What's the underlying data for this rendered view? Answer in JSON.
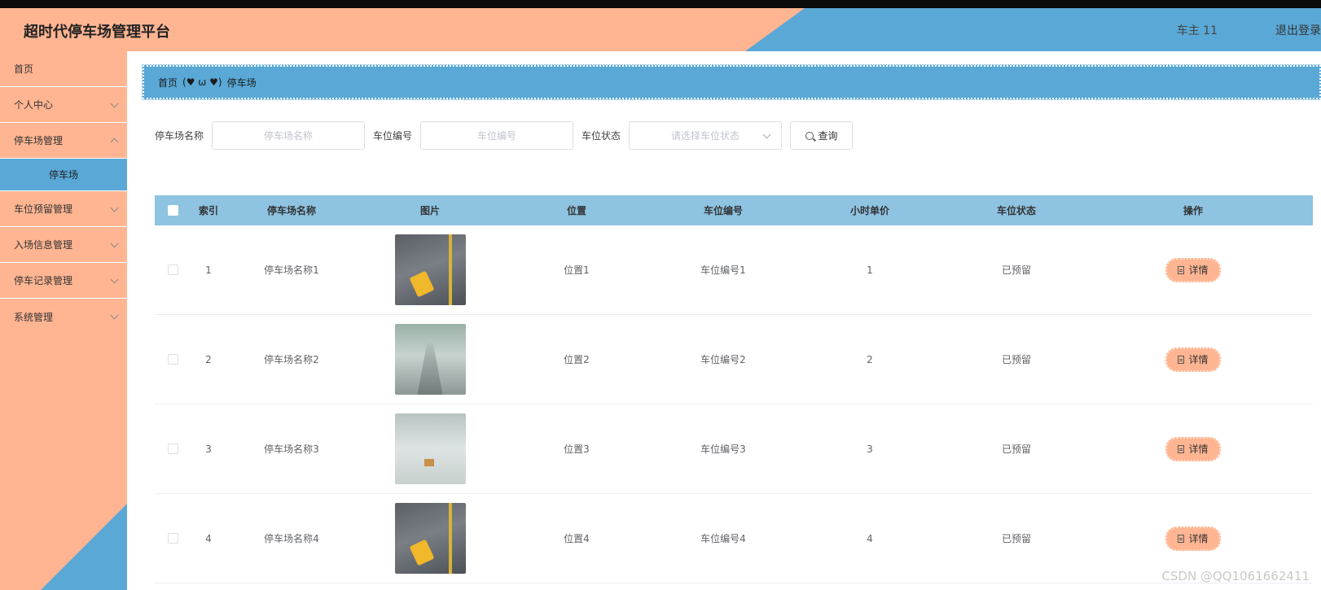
{
  "header": {
    "title": "超时代停车场管理平台",
    "user": "车主 11",
    "logout": "退出登录"
  },
  "sidebar": {
    "items": [
      {
        "label": "首页"
      },
      {
        "label": "个人中心"
      },
      {
        "label": "停车场管理"
      },
      {
        "label": "停车场"
      },
      {
        "label": "车位预留管理"
      },
      {
        "label": "入场信息管理"
      },
      {
        "label": "停车记录管理"
      },
      {
        "label": "系统管理"
      }
    ]
  },
  "breadcrumb": {
    "home": "首页",
    "separator": "(♥ ω ♥)",
    "current": "停车场"
  },
  "search": {
    "name_label": "停车场名称",
    "name_placeholder": "停车场名称",
    "no_label": "车位编号",
    "no_placeholder": "车位编号",
    "status_label": "车位状态",
    "status_placeholder": "请选择车位状态",
    "button": "查询"
  },
  "table": {
    "headers": {
      "index": "索引",
      "name": "停车场名称",
      "image": "图片",
      "position": "位置",
      "spot_no": "车位编号",
      "price": "小时单价",
      "status": "车位状态",
      "action": "操作"
    },
    "rows": [
      {
        "index": "1",
        "name": "停车场名称1",
        "position": "位置1",
        "spot_no": "车位编号1",
        "price": "1",
        "status": "已预留",
        "action": "详情"
      },
      {
        "index": "2",
        "name": "停车场名称2",
        "position": "位置2",
        "spot_no": "车位编号2",
        "price": "2",
        "status": "已预留",
        "action": "详情"
      },
      {
        "index": "3",
        "name": "停车场名称3",
        "position": "位置3",
        "spot_no": "车位编号3",
        "price": "3",
        "status": "已预留",
        "action": "详情"
      },
      {
        "index": "4",
        "name": "停车场名称4",
        "position": "位置4",
        "spot_no": "车位编号4",
        "price": "4",
        "status": "已预留",
        "action": "详情"
      }
    ]
  },
  "watermark": "CSDN @QQ1061662411",
  "colors": {
    "peach": "#ffb592",
    "blue": "#5aa8d6",
    "table_header": "#8ec3e2"
  }
}
